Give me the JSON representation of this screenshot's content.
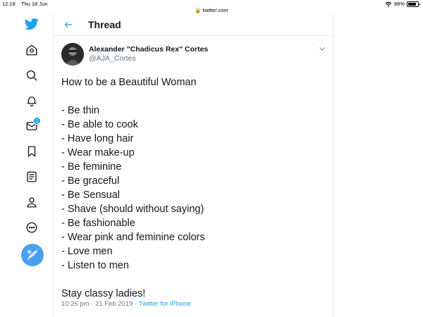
{
  "status_bar": {
    "time": "12:18",
    "date": "Thu 18 Jun",
    "url": "twitter.com",
    "battery": "88%",
    "battery_level": 0.88
  },
  "sidebar": {
    "notifications_badge": "1",
    "icons": [
      "twitter-logo-icon",
      "home-icon",
      "search-icon",
      "bell-icon",
      "envelope-icon",
      "bookmark-icon",
      "lists-icon",
      "profile-icon",
      "more-icon",
      "compose-icon"
    ]
  },
  "header": {
    "title": "Thread"
  },
  "tweet": {
    "author_name": "Alexander \"Chadicus Rex\" Cortes",
    "author_handle": "@AJA_Cortes",
    "lines": [
      "How to be a Beautiful Woman",
      "",
      "- Be thin",
      "- Be able to cook",
      "- Have long hair",
      "- Wear make-up",
      "- Be feminine",
      "- Be graceful",
      "- Be Sensual",
      "- Shave (should without saying)",
      "- Be fashionable",
      "- Wear pink and feminine colors",
      "- Love men",
      "- Listen to men",
      "",
      "Stay classy ladies!"
    ],
    "timestamp": "10:26 pm · 21 Feb 2019 · ",
    "source": "Twitter for iPhone"
  },
  "colors": {
    "accent": "#1da1f2",
    "text": "#14171a",
    "secondary": "#657786",
    "border": "#e6ecf0"
  }
}
